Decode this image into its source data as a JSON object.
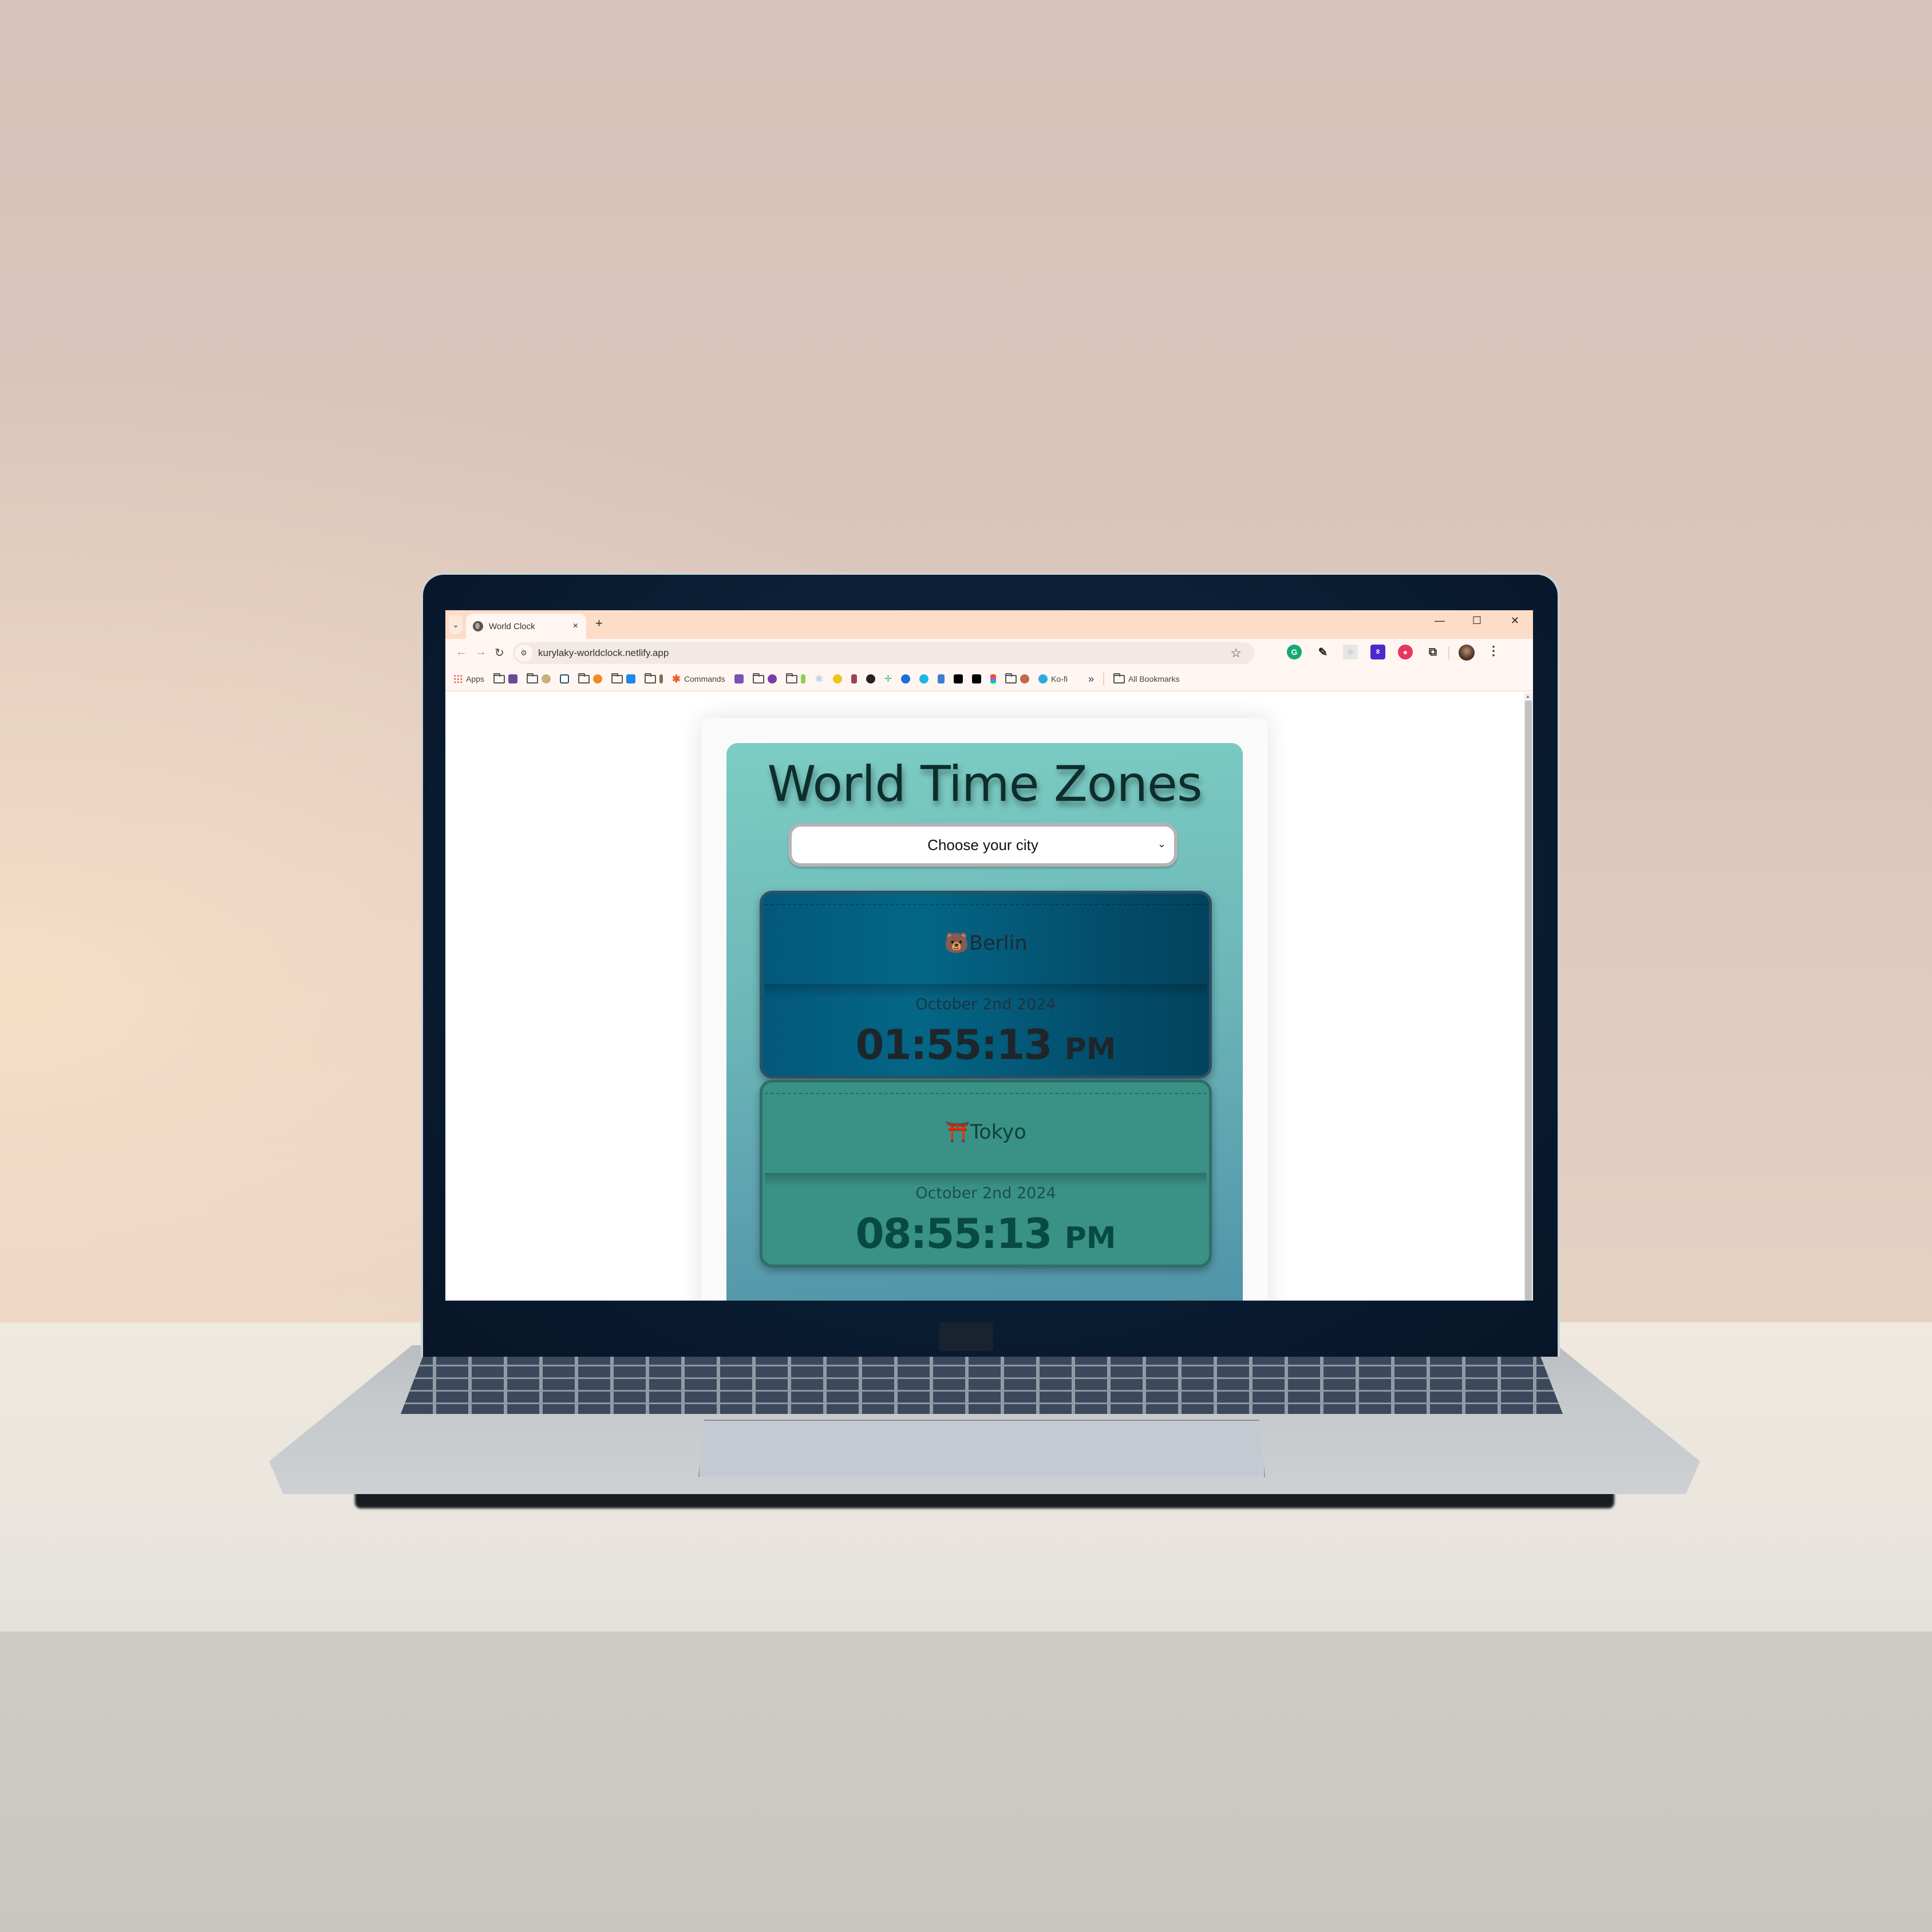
{
  "browser": {
    "tab": {
      "title": "World Clock",
      "close_glyph": "×"
    },
    "tab_search_glyph": "⌄",
    "new_tab_glyph": "+",
    "window_controls": {
      "minimize": "—",
      "maximize": "☐",
      "close": "✕"
    },
    "nav": {
      "back": "←",
      "forward": "→",
      "reload": "↻"
    },
    "url": "kurylaky-worldclock.netlify.app",
    "site_info_glyph": "⚙",
    "bookmark_star": "☆",
    "extensions": [
      {
        "name": "grammarly",
        "glyph": "G"
      },
      {
        "name": "color-picker",
        "glyph": "✎"
      },
      {
        "name": "react-devtools",
        "glyph": "⚛"
      },
      {
        "name": "layers",
        "glyph": "8",
        "badge": "8"
      },
      {
        "name": "strawberry",
        "glyph": "●"
      },
      {
        "name": "extensions-puzzle",
        "glyph": "⧉"
      }
    ],
    "menu_glyph": "⋮",
    "bookmarks": {
      "apps_label": "Apps",
      "commands_label": "Commands",
      "kofi_label": "Ko-fi",
      "more_glyph": "»",
      "all_bookmarks_label": "All Bookmarks",
      "icons": [
        "floppy",
        "person",
        "code-c",
        "fox",
        "blue-app",
        "hammer",
        "asterisk",
        "bootstrap-b",
        "gem",
        "flask",
        "react",
        "js",
        "jest",
        "github",
        "netlify",
        "c-circle",
        "search-circle",
        "flag",
        "dev",
        "medium",
        "figma",
        "person-2",
        "kofi-cup"
      ],
      "colors": {
        "bootstrap": "#7952b3",
        "js": "#f0c419",
        "react": "#61a9c8",
        "dev": "#000000",
        "medium": "#000000",
        "kofi": "#29abe0",
        "c-circle": "#1a6fd8",
        "search-circle": "#1cb7e8",
        "flag": "#3d7cd1",
        "asterisk": "#f05a28"
      }
    }
  },
  "app": {
    "title": "World Time Zones",
    "select": {
      "value": "Choose your city",
      "chevron": "⌄"
    },
    "zones": [
      {
        "emoji": "🐻",
        "city": "Berlin",
        "date": "October 2nd 2024",
        "time": "01:55:13",
        "ampm": "PM",
        "color": "#046686"
      },
      {
        "emoji": "⛩️",
        "city": "Tokyo",
        "date": "October 2nd 2024",
        "time": "08:55:13",
        "ampm": "PM",
        "color": "#3a9186"
      }
    ]
  },
  "colors": {
    "tab_bar": "#fddcc8",
    "toolbar": "#fff6f2",
    "app_gradient_top": "#7ccdc4",
    "app_gradient_bottom": "#4a8aa2",
    "title_text": "#0d2e2b"
  }
}
